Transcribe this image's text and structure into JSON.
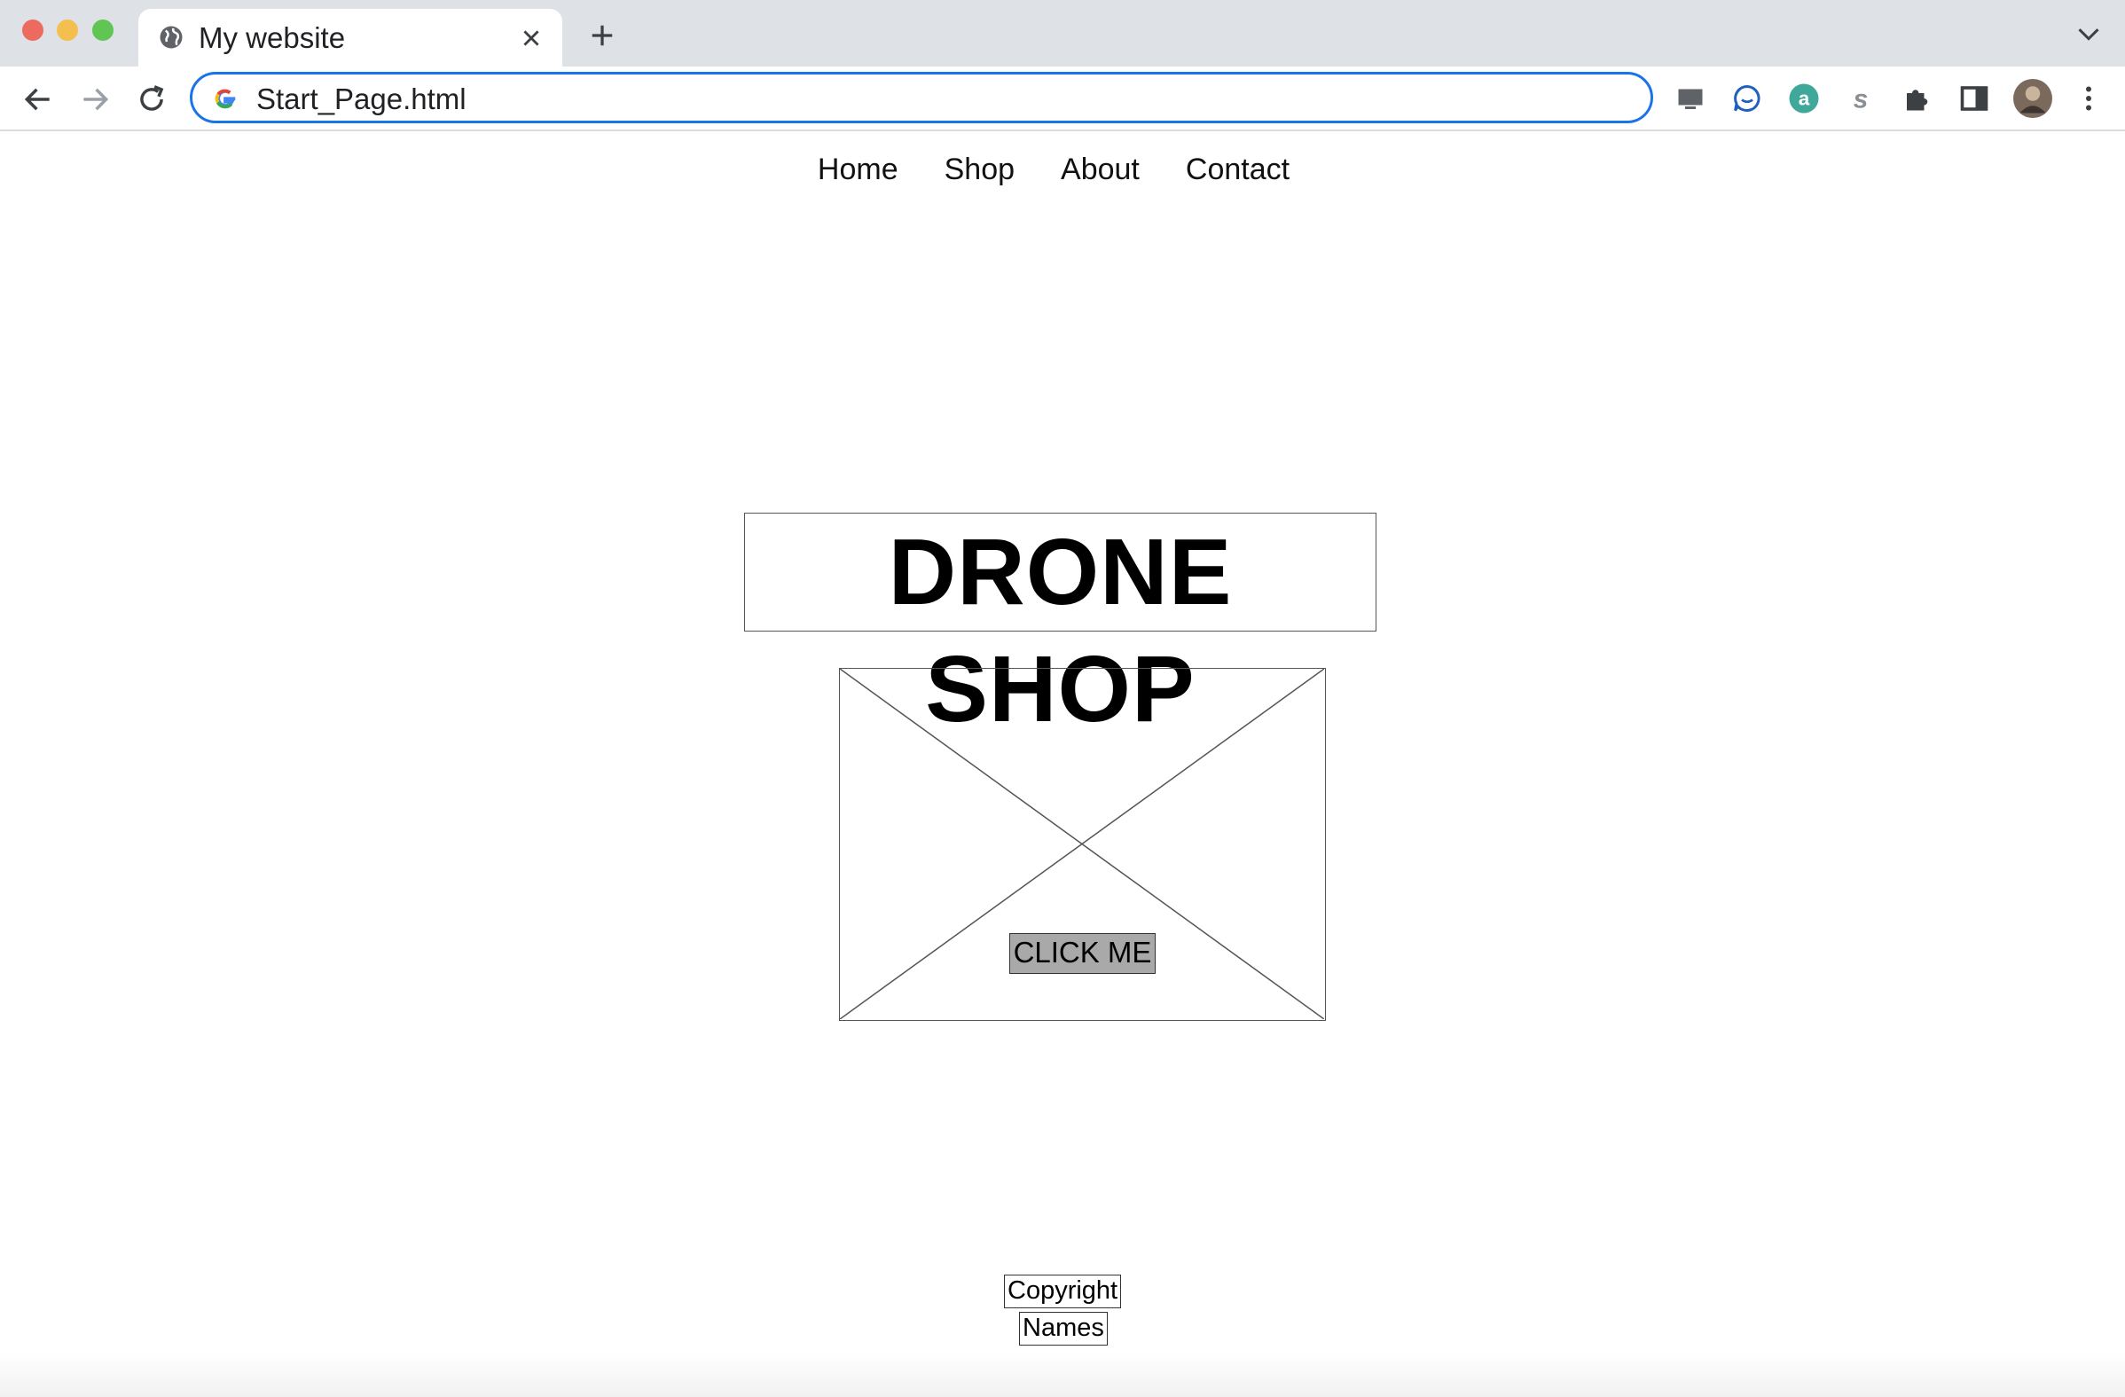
{
  "browser": {
    "tab_title": "My website",
    "address": "Start_Page.html",
    "accent": "#1a73e8"
  },
  "site": {
    "nav": [
      "Home",
      "Shop",
      "About",
      "Contact"
    ],
    "title": "DRONE SHOP",
    "image_placeholder": "image-placeholder-icon",
    "cta_label": "CLICK ME",
    "footer_line1": "Copyright",
    "footer_line2": "Names"
  }
}
